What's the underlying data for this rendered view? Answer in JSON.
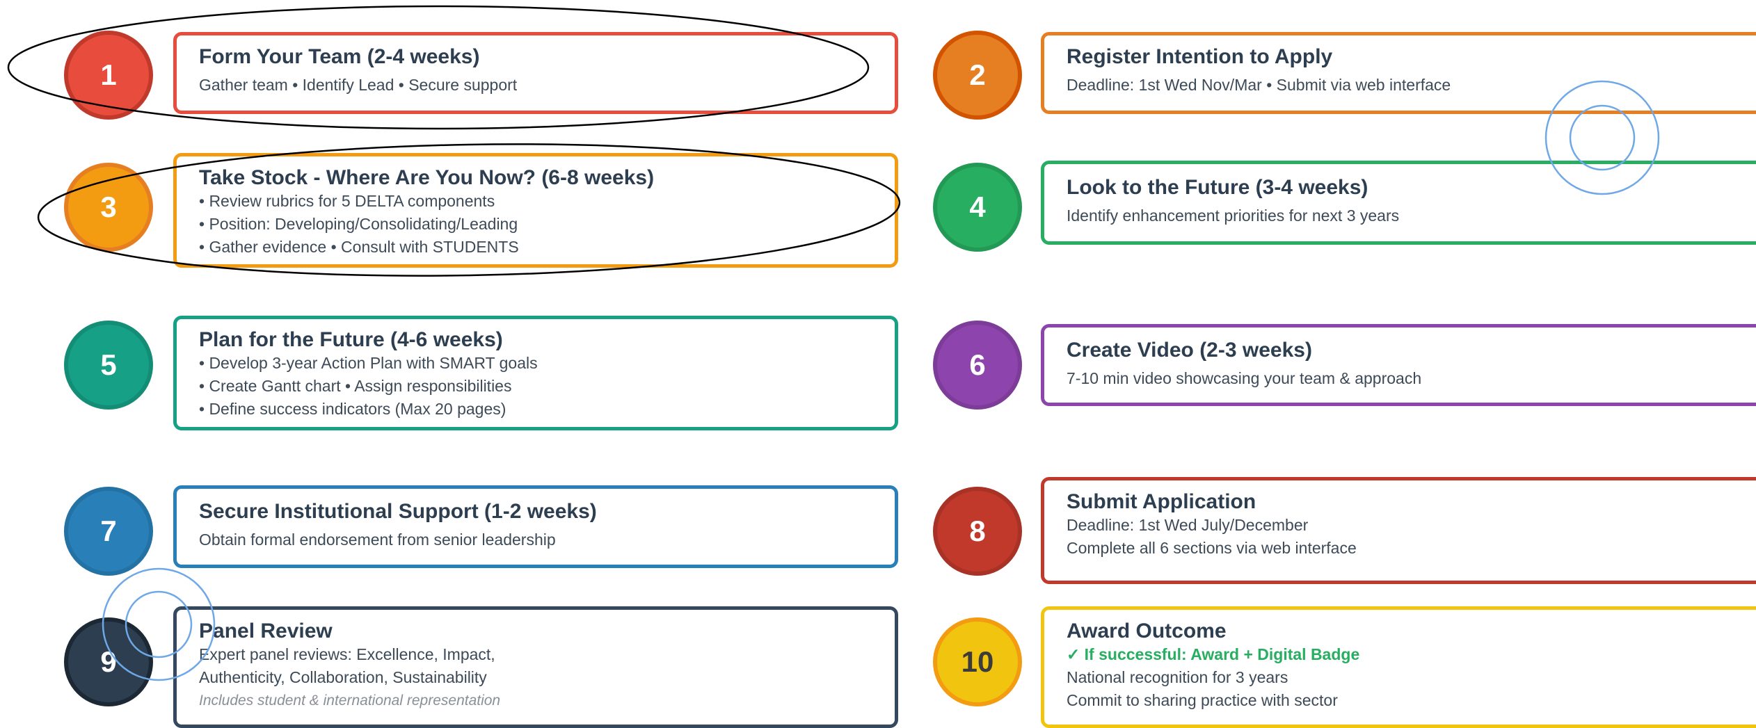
{
  "steps": [
    {
      "number": "1",
      "title": "Form Your Team (2-4 weeks)",
      "lines": [
        "Gather team • Identify Lead • Secure support"
      ],
      "color": "#e74c3c",
      "border": "#c0392b"
    },
    {
      "number": "2",
      "title": "Register Intention to Apply",
      "lines": [
        "Deadline: 1st Wed Nov/Mar • Submit via web interface"
      ],
      "color": "#e67e22",
      "border": "#d35400"
    },
    {
      "number": "3",
      "title": "Take Stock - Where Are You Now? (6-8 weeks)",
      "lines": [
        "• Review rubrics for 5 DELTA components",
        "• Position: Developing/Consolidating/Leading",
        "• Gather evidence • Consult with STUDENTS"
      ],
      "color": "#f39c12",
      "border": "#e67e22"
    },
    {
      "number": "4",
      "title": "Look to the Future (3-4 weeks)",
      "lines": [
        "Identify enhancement priorities for next 3 years"
      ],
      "color": "#27ae60",
      "border": "#229954"
    },
    {
      "number": "5",
      "title": "Plan for the Future (4-6 weeks)",
      "lines": [
        "• Develop 3-year Action Plan with SMART goals",
        "• Create Gantt chart • Assign responsibilities",
        "• Define success indicators (Max 20 pages)"
      ],
      "color": "#16a085",
      "border": "#138d75"
    },
    {
      "number": "6",
      "title": "Create Video (2-3 weeks)",
      "lines": [
        "7-10 min video showcasing your team & approach"
      ],
      "color": "#8e44ad",
      "border": "#7d3c98"
    },
    {
      "number": "7",
      "title": "Secure Institutional Support (1-2 weeks)",
      "lines": [
        "Obtain formal endorsement from senior leadership"
      ],
      "color": "#2980b9",
      "border": "#2471a3"
    },
    {
      "number": "8",
      "title": "Submit Application",
      "lines": [
        "Deadline: 1st Wed July/December",
        "Complete all 6 sections via web interface"
      ],
      "color": "#c0392b",
      "border": "#a93226"
    },
    {
      "number": "9",
      "title": "Panel Review",
      "lines": [
        "Expert panel reviews: Excellence, Impact,",
        "Authenticity, Collaboration, Sustainability"
      ],
      "note": "Includes student & international representation",
      "color": "#2c3e50",
      "border": "#1c2833"
    },
    {
      "number": "10",
      "title": "Award Outcome",
      "success": "✓ If successful: Award + Digital Badge",
      "lines": [
        "National recognition for 3 years",
        "Commit to sharing practice with sector"
      ],
      "color": "#f1c40f",
      "border": "#f39c12"
    }
  ]
}
